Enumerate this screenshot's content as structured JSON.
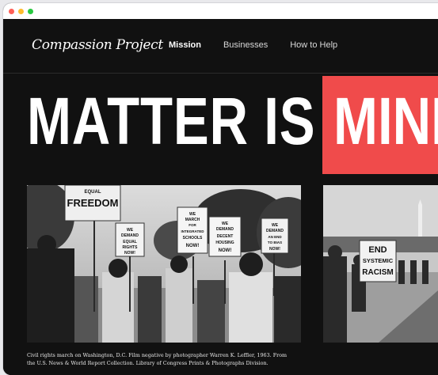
{
  "window": {
    "controls": [
      "close",
      "minimize",
      "zoom"
    ]
  },
  "nav": {
    "logo": "Compassion Project",
    "links": [
      {
        "label": "Mission",
        "active": true
      },
      {
        "label": "Businesses",
        "active": false
      },
      {
        "label": "How to Help",
        "active": false
      }
    ]
  },
  "hero": {
    "headline": "MATTER IS THE",
    "highlight": "MINIM",
    "highlight_color": "#f04b4b"
  },
  "photos": {
    "photo_1_signs": [
      "EQUAL FREEDOM",
      "WE DEMAND EQUAL RIGHTS NOW!",
      "WE MARCH FOR INTEGRATED SCHOOLS NOW!",
      "WE DEMAND DECENT HOUSING NOW!",
      "WE DEMAND AN END TO BIAS NOW!"
    ],
    "photo_2_signs": [
      "END SYSTEMIC RACISM"
    ]
  },
  "caption": "Civil rights march on Washington, D.C. Film negative by photographer Warren K. Leffler, 1963. From the U.S. News & World Report Collection. Library of Congress Prints & Photographs Division.",
  "colors": {
    "background": "#111111",
    "accent": "#f04b4b",
    "text": "#ffffff"
  }
}
